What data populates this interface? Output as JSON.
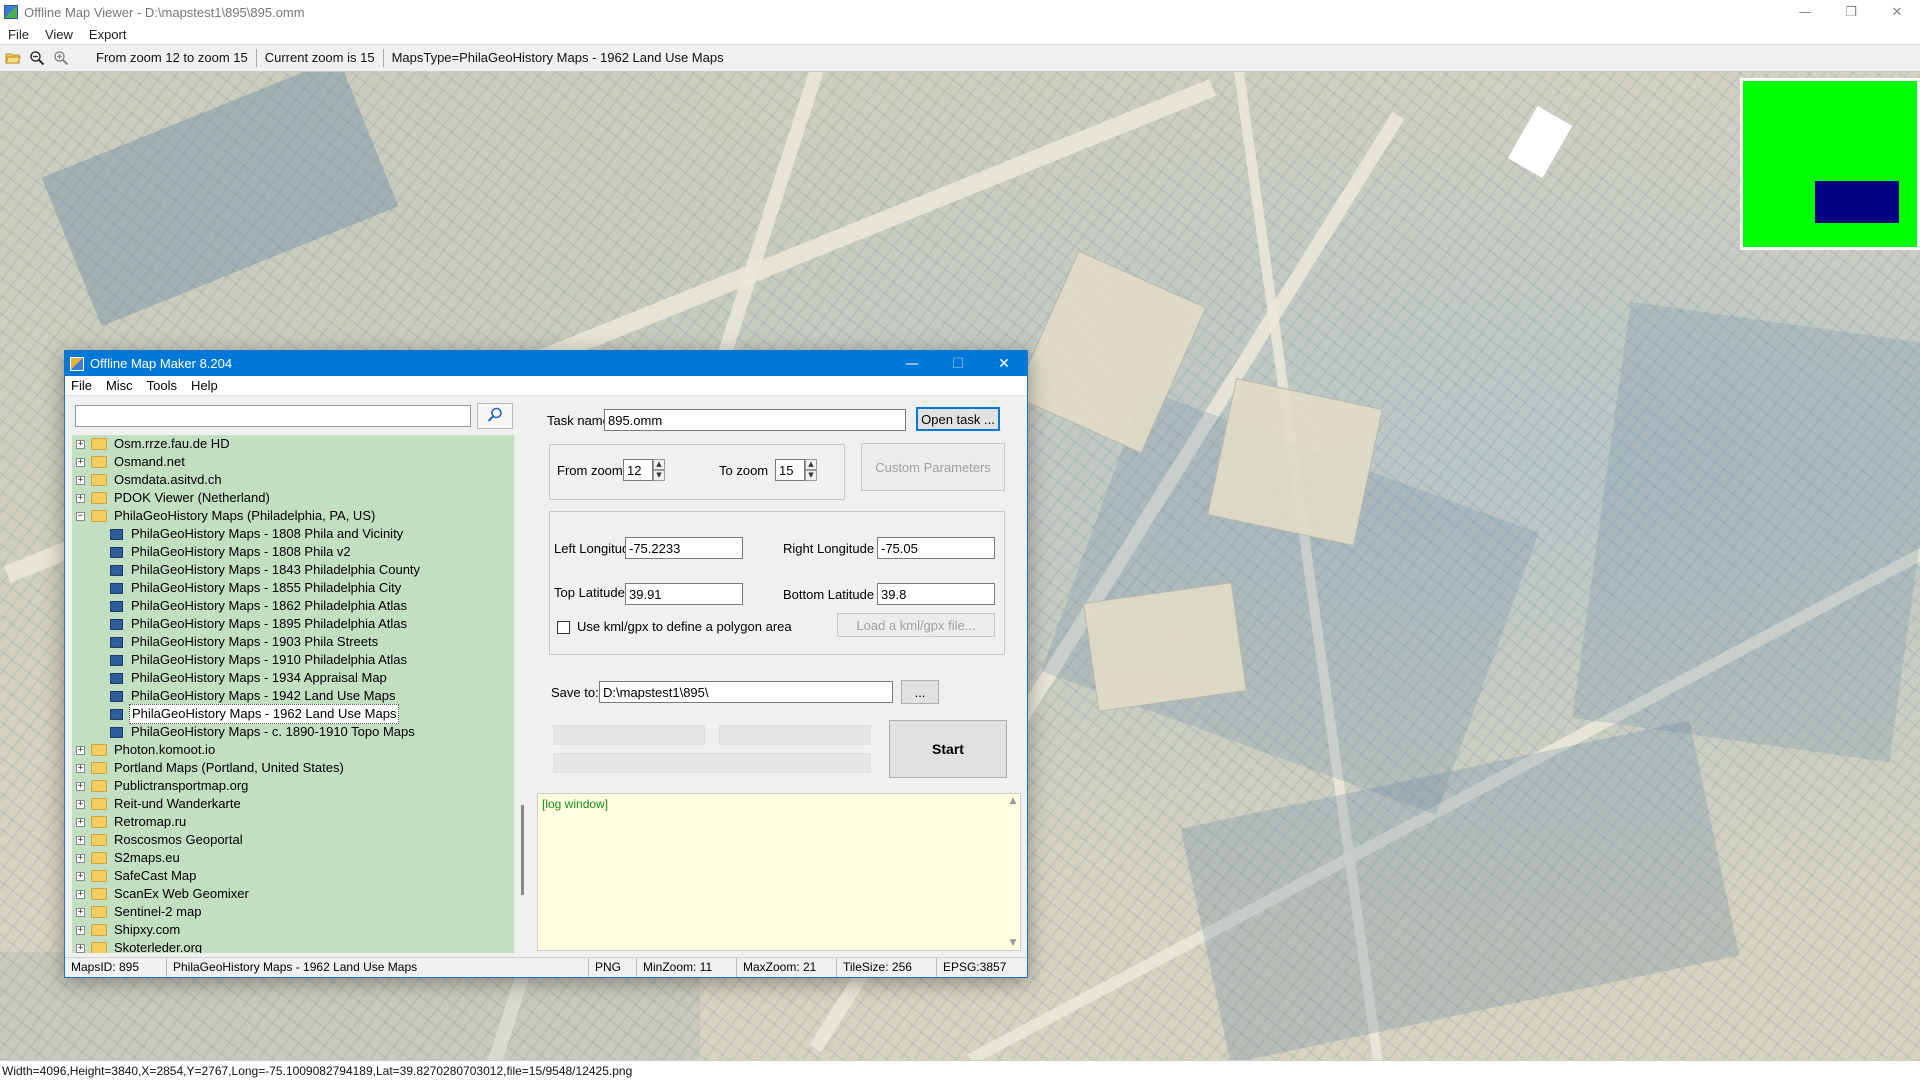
{
  "app": {
    "title": "Offline Map Viewer - D:\\mapstest1\\895\\895.omm",
    "window_buttons": [
      "—",
      "❐",
      "✕"
    ]
  },
  "menu": [
    "File",
    "View",
    "Export"
  ],
  "toolbar": {
    "icons": [
      "open-folder-icon",
      "zoom-out-icon",
      "zoom-in-icon"
    ],
    "zoom_range": "From zoom 12 to zoom 15",
    "current_zoom": "Current zoom is 15",
    "maps_type": "MapsType=PhilaGeoHistory Maps - 1962 Land Use Maps"
  },
  "overview": {
    "frame_color": "#00ff00",
    "viewport_color": "#000080"
  },
  "statusbar": "Width=4096,Height=3840,X=2854,Y=2767,Long=-75.1009082794189,Lat=39.8270280703012,file=15/9548/12425.png",
  "dialog": {
    "title": "Offline Map Maker 8.204",
    "menu": [
      "File",
      "Misc",
      "Tools",
      "Help"
    ],
    "search": {
      "value": "",
      "icon": "search-icon"
    },
    "tree": [
      {
        "label": "Osm.rrze.fau.de HD",
        "level": 0,
        "expander": "+"
      },
      {
        "label": "Osmand.net",
        "level": 0,
        "expander": "+"
      },
      {
        "label": "Osmdata.asitvd.ch",
        "level": 0,
        "expander": "+"
      },
      {
        "label": "PDOK Viewer (Netherland)",
        "level": 0,
        "expander": "+"
      },
      {
        "label": "PhilaGeoHistory Maps (Philadelphia, PA, US)",
        "level": 0,
        "expander": "−"
      },
      {
        "label": "PhilaGeoHistory Maps - 1808 Phila and Vicinity",
        "level": 1
      },
      {
        "label": "PhilaGeoHistory Maps - 1808 Phila v2",
        "level": 1
      },
      {
        "label": "PhilaGeoHistory Maps - 1843 Philadelphia County",
        "level": 1
      },
      {
        "label": "PhilaGeoHistory Maps - 1855 Philadelphia City",
        "level": 1
      },
      {
        "label": "PhilaGeoHistory Maps - 1862 Philadelphia Atlas",
        "level": 1
      },
      {
        "label": "PhilaGeoHistory Maps - 1895 Philadelphia Atlas",
        "level": 1
      },
      {
        "label": "PhilaGeoHistory Maps - 1903 Phila Streets",
        "level": 1
      },
      {
        "label": "PhilaGeoHistory Maps - 1910 Philadelphia Atlas",
        "level": 1
      },
      {
        "label": "PhilaGeoHistory Maps - 1934 Appraisal Map",
        "level": 1
      },
      {
        "label": "PhilaGeoHistory Maps - 1942 Land Use Maps",
        "level": 1
      },
      {
        "label": "PhilaGeoHistory Maps - 1962 Land Use Maps",
        "level": 1,
        "selected": true
      },
      {
        "label": "PhilaGeoHistory Maps - c. 1890-1910 Topo Maps",
        "level": 1
      },
      {
        "label": "Photon.komoot.io",
        "level": 0,
        "expander": "+"
      },
      {
        "label": "Portland Maps (Portland, United States)",
        "level": 0,
        "expander": "+"
      },
      {
        "label": "Publictransportmap.org",
        "level": 0,
        "expander": "+"
      },
      {
        "label": "Reit-und Wanderkarte",
        "level": 0,
        "expander": "+"
      },
      {
        "label": "Retromap.ru",
        "level": 0,
        "expander": "+"
      },
      {
        "label": "Roscosmos Geoportal",
        "level": 0,
        "expander": "+"
      },
      {
        "label": "S2maps.eu",
        "level": 0,
        "expander": "+"
      },
      {
        "label": "SafeCast Map",
        "level": 0,
        "expander": "+"
      },
      {
        "label": "ScanEx Web Geomixer",
        "level": 0,
        "expander": "+"
      },
      {
        "label": "Sentinel-2 map",
        "level": 0,
        "expander": "+"
      },
      {
        "label": "Shipxy.com",
        "level": 0,
        "expander": "+"
      },
      {
        "label": "Skoterleder.org",
        "level": 0,
        "expander": "+"
      }
    ],
    "task_name_label": "Task name",
    "task_name_value": "895.omm",
    "open_task": "Open task ...",
    "from_zoom_label": "From zoom",
    "from_zoom_value": "12",
    "to_zoom_label": "To zoom",
    "to_zoom_value": "15",
    "custom_params": "Custom Parameters",
    "left_lon_label": "Left Longitude",
    "left_lon_value": "-75.2233",
    "right_lon_label": "Right Longitude",
    "right_lon_value": "-75.05",
    "top_lat_label": "Top Latitude",
    "top_lat_value": "39.91",
    "bottom_lat_label": "Bottom Latitude",
    "bottom_lat_value": "39.8",
    "kml_checkbox_label": "Use kml/gpx to define a polygon area",
    "load_kml": "Load a kml/gpx file...",
    "save_to_label": "Save to:",
    "save_to_value": "D:\\mapstest1\\895\\",
    "browse": "...",
    "start": "Start",
    "log_text": "[log window]",
    "status": {
      "maps_id": "MapsID: 895",
      "maps_name": "PhilaGeoHistory Maps - 1962 Land Use Maps",
      "format": "PNG",
      "min_zoom": "MinZoom: 11",
      "max_zoom": "MaxZoom: 21",
      "tile_size": "TileSize: 256",
      "epsg": "EPSG:3857"
    }
  }
}
